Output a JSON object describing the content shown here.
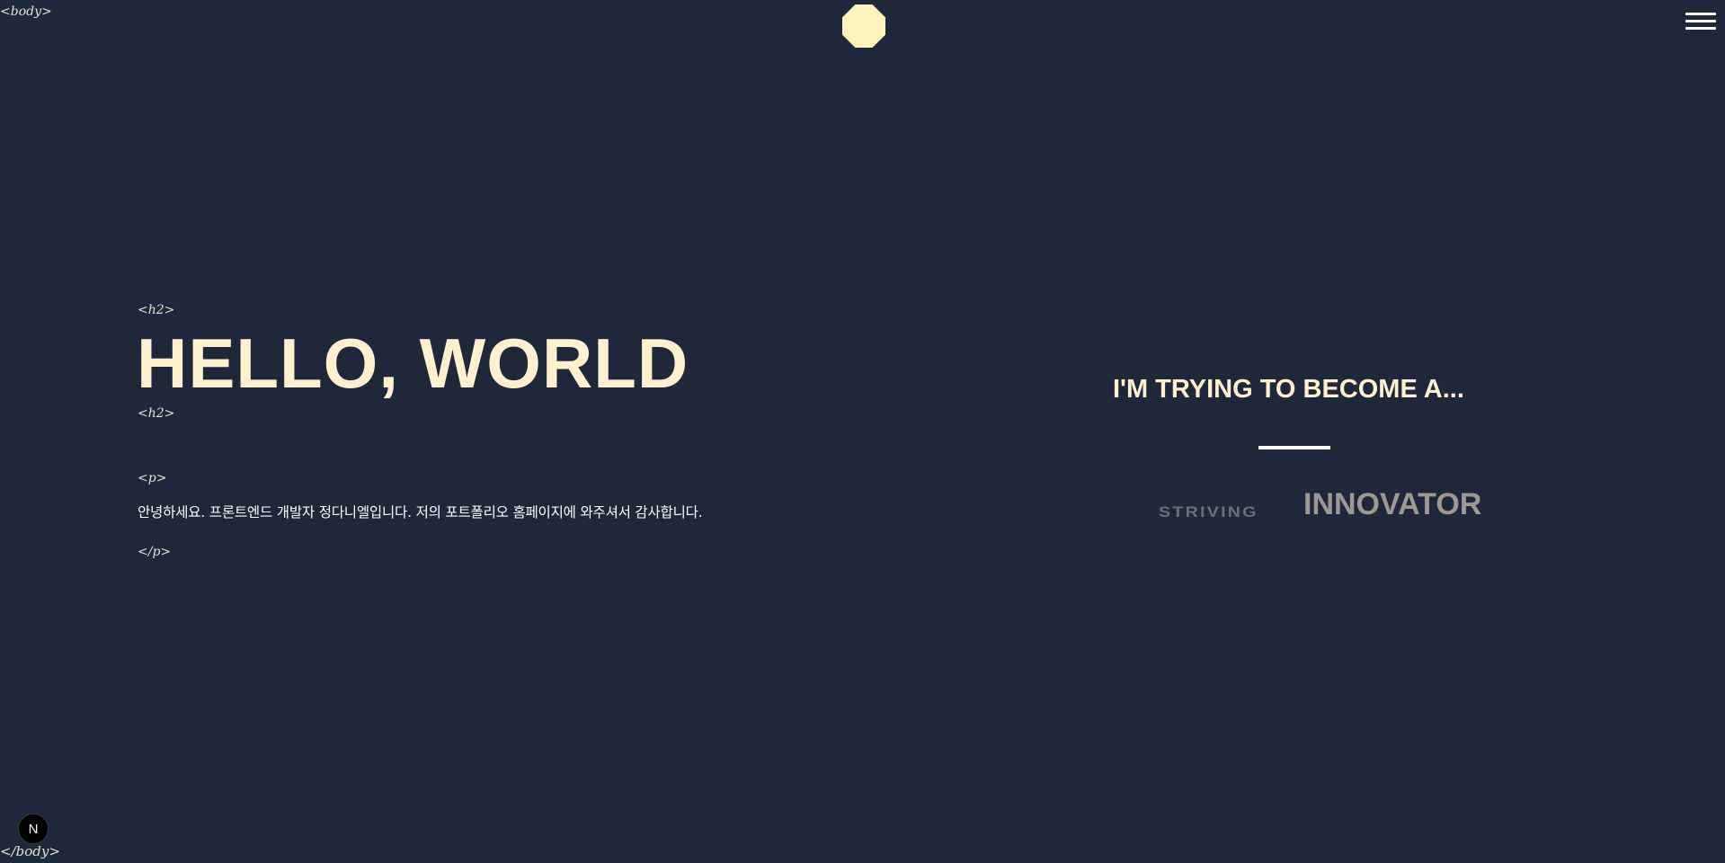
{
  "tags": {
    "body_open": "<body>",
    "body_close": "</body>",
    "h2_open": "<h2>",
    "h2_close": "<h2>",
    "p_open": "<p>",
    "p_close": "</p>"
  },
  "header": {
    "logo_icon": "octagon-logo-icon",
    "menu_icon": "hamburger-menu-icon"
  },
  "hero": {
    "title": "HELLO, WORLD",
    "intro": "안녕하세요. 프론트엔드 개발자 정다니엘입니다. 저의 포트폴리오 홈페이지에 와주셔서 감사합니다."
  },
  "roles": {
    "heading": "I'M TRYING TO BECOME A...",
    "words": [
      "STRIVING",
      "INNOVATOR"
    ]
  },
  "badge": {
    "label": "N"
  },
  "colors": {
    "background": "#1f283b",
    "accent": "#fff2bd",
    "title": "#fff1d0"
  }
}
